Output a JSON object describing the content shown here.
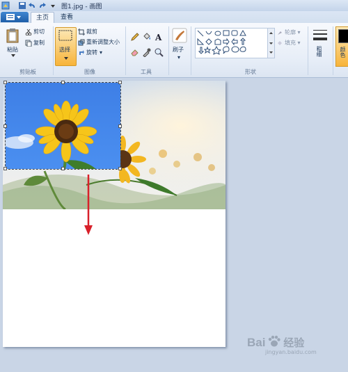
{
  "window": {
    "title": "图1.jpg - 画图"
  },
  "tabs": [
    {
      "label": "主页"
    },
    {
      "label": "查看"
    }
  ],
  "ribbon": {
    "clipboard": {
      "paste": "粘贴",
      "cut": "剪切",
      "copy": "复制",
      "group_label": "剪贴板"
    },
    "image": {
      "select": "选择",
      "crop": "裁剪",
      "resize": "重新调整大小",
      "rotate": "旋转",
      "group_label": "图像"
    },
    "tools": {
      "group_label": "工具"
    },
    "brushes": {
      "label": "刷子"
    },
    "shapes": {
      "outline": "轮廓",
      "fill": "填充",
      "group_label": "形状"
    },
    "size": {
      "label": "粗细"
    },
    "colors": {
      "color1": "颜色"
    }
  },
  "watermark": {
    "brand": "Bai",
    "site": "经验",
    "url": "jingyan.baidu.com"
  },
  "colors": {
    "accent": "#f7b43a",
    "arrow": "#d8202a",
    "selection_bg": "#3e7fe6"
  }
}
